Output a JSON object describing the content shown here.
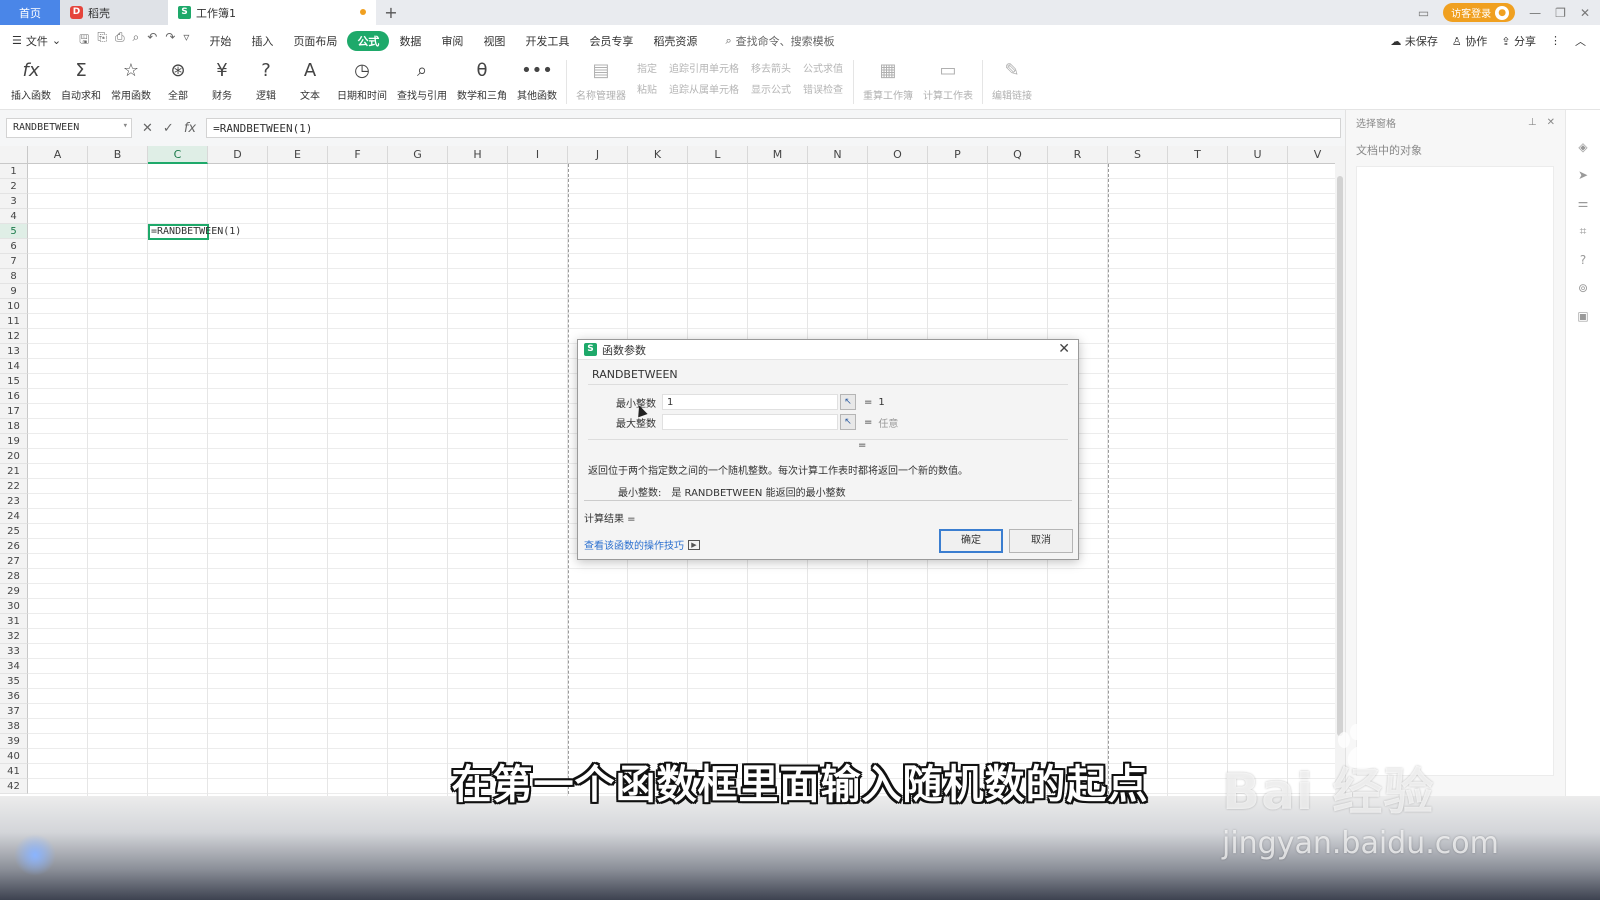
{
  "tabs": {
    "home": "首页",
    "daoke": "稻壳",
    "workbook": "工作簿1",
    "add": "+",
    "login": "访客登录"
  },
  "menubar": {
    "file": "文件",
    "items": [
      "开始",
      "插入",
      "页面布局",
      "公式",
      "数据",
      "审阅",
      "视图",
      "开发工具",
      "会员专享",
      "稻壳资源"
    ],
    "active_item": "公式",
    "search_placeholder": "查找命令、搜索模板",
    "unsaved": "未保存",
    "collab": "协作",
    "share": "分享"
  },
  "ribbon": {
    "buttons": [
      {
        "label": "插入函数",
        "icon": "fx-icon"
      },
      {
        "label": "自动求和",
        "icon": "sigma-icon"
      },
      {
        "label": "常用函数",
        "icon": "star-icon"
      },
      {
        "label": "全部",
        "icon": "asterisk-icon"
      },
      {
        "label": "财务",
        "icon": "yen-icon"
      },
      {
        "label": "逻辑",
        "icon": "question-icon"
      },
      {
        "label": "文本",
        "icon": "text-icon"
      },
      {
        "label": "日期和时间",
        "icon": "clock-icon"
      },
      {
        "label": "查找与引用",
        "icon": "search-icon"
      },
      {
        "label": "数学和三角",
        "icon": "theta-icon"
      },
      {
        "label": "其他函数",
        "icon": "more-icon"
      }
    ],
    "name_manager": "名称管理器",
    "small_col1": [
      "指定",
      "粘贴"
    ],
    "small_col2": [
      "追踪引用单元格",
      "追踪从属单元格"
    ],
    "small_col3": [
      "移去箭头",
      "显示公式"
    ],
    "small_col4": [
      "公式求值",
      "错误检查"
    ],
    "recalc_sheet": "重算工作簿",
    "calc_sheet": "计算工作表",
    "edit_links": "编辑链接"
  },
  "formula_bar": {
    "name_box": "RANDBETWEEN",
    "formula": "=RANDBETWEEN(1)"
  },
  "grid": {
    "columns": [
      "A",
      "B",
      "C",
      "D",
      "E",
      "F",
      "G",
      "H",
      "I",
      "J",
      "K",
      "L",
      "M",
      "N",
      "O",
      "P",
      "Q",
      "R",
      "S",
      "T",
      "U",
      "V"
    ],
    "selected_column": "C",
    "selected_row": 5,
    "row_count": 42,
    "active_cell_text": "=RANDBETWEEN(1)"
  },
  "side_panel": {
    "header": "选择窗格",
    "label": "文档中的对象"
  },
  "dialog": {
    "title": "函数参数",
    "function_name": "RANDBETWEEN",
    "args": [
      {
        "label": "最小整数",
        "value": "1",
        "result": "1"
      },
      {
        "label": "最大整数",
        "value": "",
        "result": "任意"
      }
    ],
    "equals": "=",
    "description": "返回位于两个指定数之间的一个随机整数。每次计算工作表时都将返回一个新的数值。",
    "param_name": "最小整数:",
    "param_desc": "是 RANDBETWEEN 能返回的最小整数",
    "result_label": "计算结果 =",
    "help_link": "查看该函数的操作技巧",
    "ok": "确定",
    "cancel": "取消"
  },
  "caption": "在第一个函数框里面输入随机数的起点",
  "watermark": {
    "line1": "Bai 经验",
    "line2": "jingyan.baidu.com"
  },
  "colors": {
    "accent": "#1ea96a",
    "home_tab": "#4a86e8",
    "login": "#f0a020"
  }
}
